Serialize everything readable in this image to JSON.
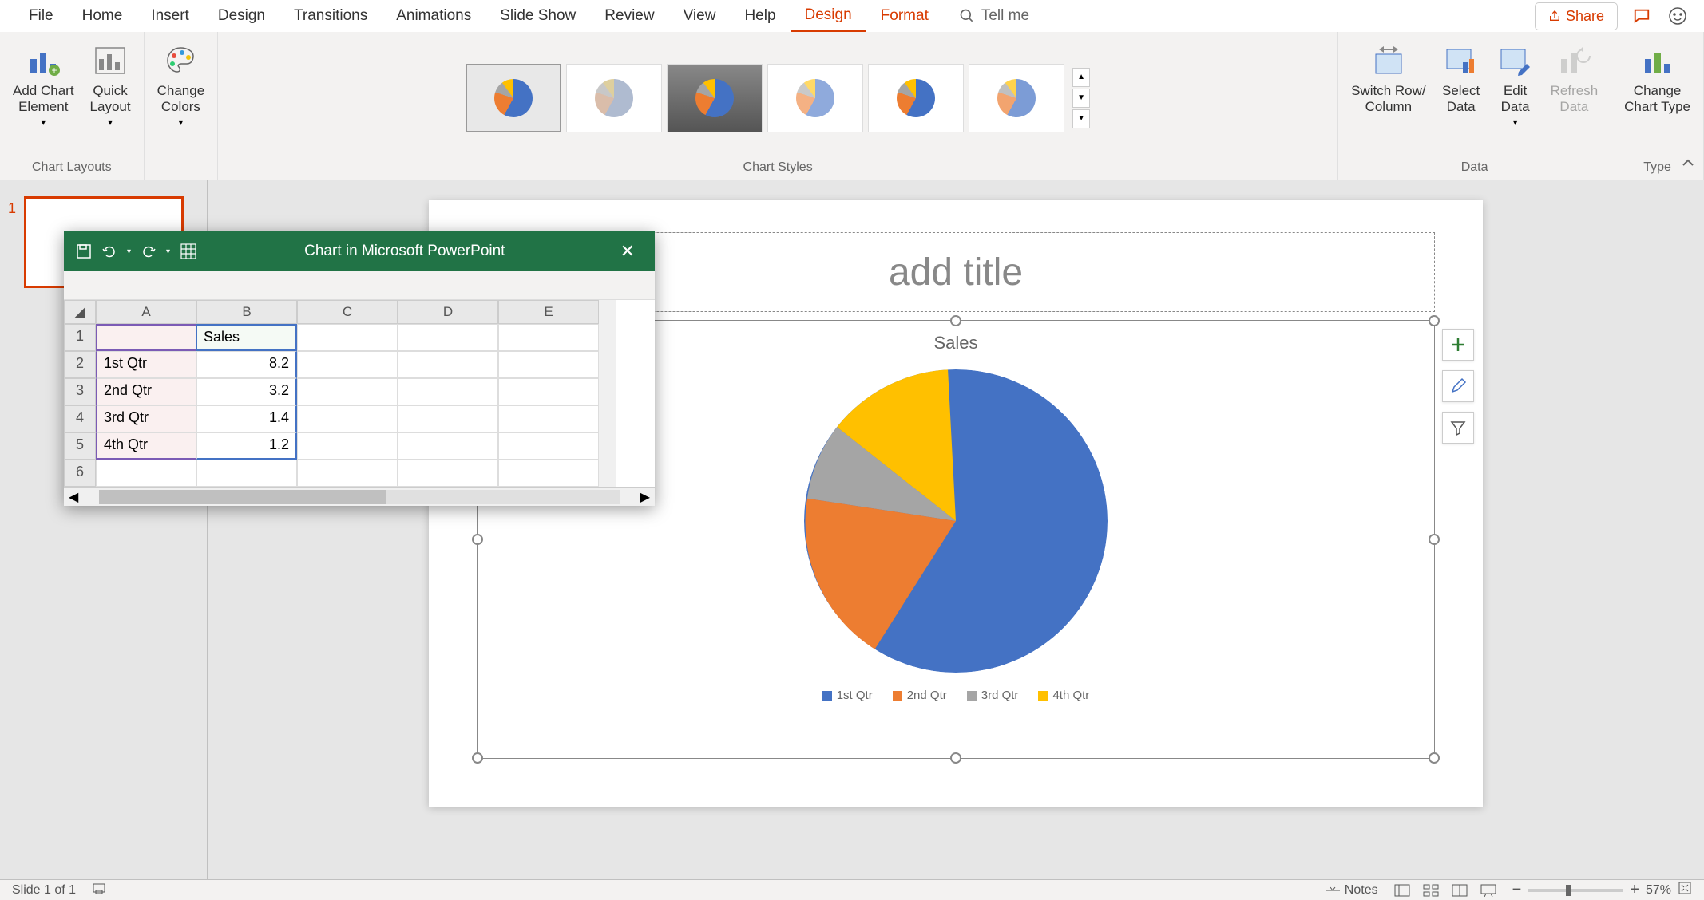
{
  "menubar": {
    "items": [
      "File",
      "Home",
      "Insert",
      "Design",
      "Transitions",
      "Animations",
      "Slide Show",
      "Review",
      "View",
      "Help"
    ],
    "contextual": [
      "Design",
      "Format"
    ],
    "tellme": "Tell me",
    "share": "Share"
  },
  "ribbon": {
    "groups": {
      "chart_layouts": {
        "label": "Chart Layouts",
        "add_element": "Add Chart\nElement",
        "quick_layout": "Quick\nLayout"
      },
      "change_colors": {
        "label": "Change\nColors"
      },
      "chart_styles": {
        "label": "Chart Styles"
      },
      "data": {
        "label": "Data",
        "switch": "Switch Row/\nColumn",
        "select": "Select\nData",
        "edit": "Edit\nData",
        "refresh": "Refresh\nData"
      },
      "type": {
        "label": "Type",
        "change": "Change\nChart Type"
      }
    }
  },
  "thumbnail": {
    "number": "1"
  },
  "slide": {
    "title_placeholder": "add title",
    "chart_title": "Sales",
    "legend": [
      "1st Qtr",
      "2nd Qtr",
      "3rd Qtr",
      "4th Qtr"
    ]
  },
  "excel_popup": {
    "title": "Chart in Microsoft PowerPoint",
    "columns": [
      "A",
      "B",
      "C",
      "D",
      "E"
    ],
    "header_b": "Sales",
    "rows": [
      {
        "n": "1",
        "a": "",
        "b": "Sales"
      },
      {
        "n": "2",
        "a": "1st Qtr",
        "b": "8.2"
      },
      {
        "n": "3",
        "a": "2nd Qtr",
        "b": "3.2"
      },
      {
        "n": "4",
        "a": "3rd Qtr",
        "b": "1.4"
      },
      {
        "n": "5",
        "a": "4th Qtr",
        "b": "1.2"
      },
      {
        "n": "6",
        "a": "",
        "b": ""
      }
    ]
  },
  "statusbar": {
    "slide_info": "Slide 1 of 1",
    "notes": "Notes",
    "zoom": "57%"
  },
  "chart_data": {
    "type": "pie",
    "title": "Sales",
    "categories": [
      "1st Qtr",
      "2nd Qtr",
      "3rd Qtr",
      "4th Qtr"
    ],
    "values": [
      8.2,
      3.2,
      1.4,
      1.2
    ],
    "colors": [
      "#4472c4",
      "#ed7d31",
      "#a5a5a5",
      "#ffc000"
    ]
  }
}
